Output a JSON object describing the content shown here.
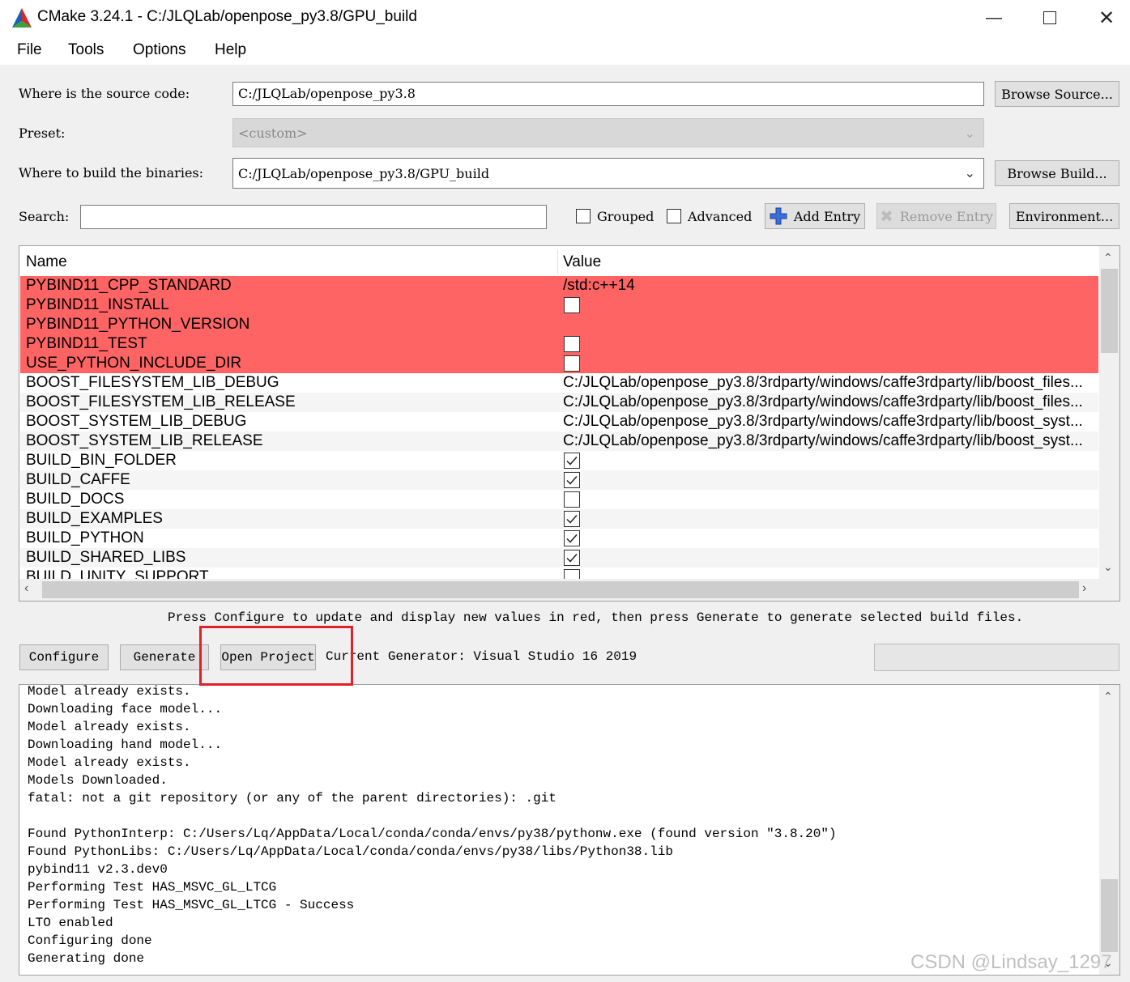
{
  "window": {
    "title": "CMake 3.24.1 - C:/JLQLab/openpose_py3.8/GPU_build"
  },
  "menu": [
    "File",
    "Tools",
    "Options",
    "Help"
  ],
  "source": {
    "label": "Where is the source code:",
    "value": "C:/JLQLab/openpose_py3.8",
    "browse": "Browse Source..."
  },
  "preset": {
    "label": "Preset:",
    "value": "<custom>"
  },
  "build": {
    "label": "Where to build the binaries:",
    "value": "C:/JLQLab/openpose_py3.8/GPU_build",
    "browse": "Browse Build..."
  },
  "search": {
    "label": "Search:",
    "value": ""
  },
  "options": {
    "grouped": "Grouped",
    "advanced": "Advanced",
    "add_entry": "Add Entry",
    "remove_entry": "Remove Entry",
    "environment": "Environment..."
  },
  "table": {
    "headers": {
      "name": "Name",
      "value": "Value"
    },
    "rows": [
      {
        "name": "PYBIND11_CPP_STANDARD",
        "value": "/std:c++14",
        "red": true
      },
      {
        "name": "PYBIND11_INSTALL",
        "check": "off",
        "red": true
      },
      {
        "name": "PYBIND11_PYTHON_VERSION",
        "value": "",
        "red": true
      },
      {
        "name": "PYBIND11_TEST",
        "check": "off",
        "red": true
      },
      {
        "name": "USE_PYTHON_INCLUDE_DIR",
        "check": "off",
        "red": true
      },
      {
        "name": "BOOST_FILESYSTEM_LIB_DEBUG",
        "value": "C:/JLQLab/openpose_py3.8/3rdparty/windows/caffe3rdparty/lib/boost_files..."
      },
      {
        "name": "BOOST_FILESYSTEM_LIB_RELEASE",
        "value": "C:/JLQLab/openpose_py3.8/3rdparty/windows/caffe3rdparty/lib/boost_files..."
      },
      {
        "name": "BOOST_SYSTEM_LIB_DEBUG",
        "value": "C:/JLQLab/openpose_py3.8/3rdparty/windows/caffe3rdparty/lib/boost_syst..."
      },
      {
        "name": "BOOST_SYSTEM_LIB_RELEASE",
        "value": "C:/JLQLab/openpose_py3.8/3rdparty/windows/caffe3rdparty/lib/boost_syst..."
      },
      {
        "name": "BUILD_BIN_FOLDER",
        "check": "on"
      },
      {
        "name": "BUILD_CAFFE",
        "check": "on"
      },
      {
        "name": "BUILD_DOCS",
        "check": "off"
      },
      {
        "name": "BUILD_EXAMPLES",
        "check": "on"
      },
      {
        "name": "BUILD_PYTHON",
        "check": "on"
      },
      {
        "name": "BUILD_SHARED_LIBS",
        "check": "on"
      },
      {
        "name": "BUILD_UNITY_SUPPORT",
        "check": "off"
      }
    ]
  },
  "hint": "Press Configure to update and display new values in red, then press Generate to generate selected build files.",
  "actions": {
    "configure": "Configure",
    "generate": "Generate",
    "open_project": "Open Project",
    "generator": "Current Generator: Visual Studio 16 2019"
  },
  "log": [
    "Model already exists.",
    "Downloading face model...",
    "Model already exists.",
    "Downloading hand model...",
    "Model already exists.",
    "Models Downloaded.",
    "fatal: not a git repository (or any of the parent directories): .git",
    "",
    "Found PythonInterp: C:/Users/Lq/AppData/Local/conda/conda/envs/py38/pythonw.exe (found version \"3.8.20\")",
    "Found PythonLibs: C:/Users/Lq/AppData/Local/conda/conda/envs/py38/libs/Python38.lib",
    "pybind11 v2.3.dev0",
    "Performing Test HAS_MSVC_GL_LTCG",
    "Performing Test HAS_MSVC_GL_LTCG - Success",
    "LTO enabled",
    "Configuring done",
    "Generating done"
  ],
  "watermark": "CSDN @Lindsay_1297",
  "colors": {
    "new_value_red": "#ff6464",
    "highlight_box": "#e0202a"
  }
}
